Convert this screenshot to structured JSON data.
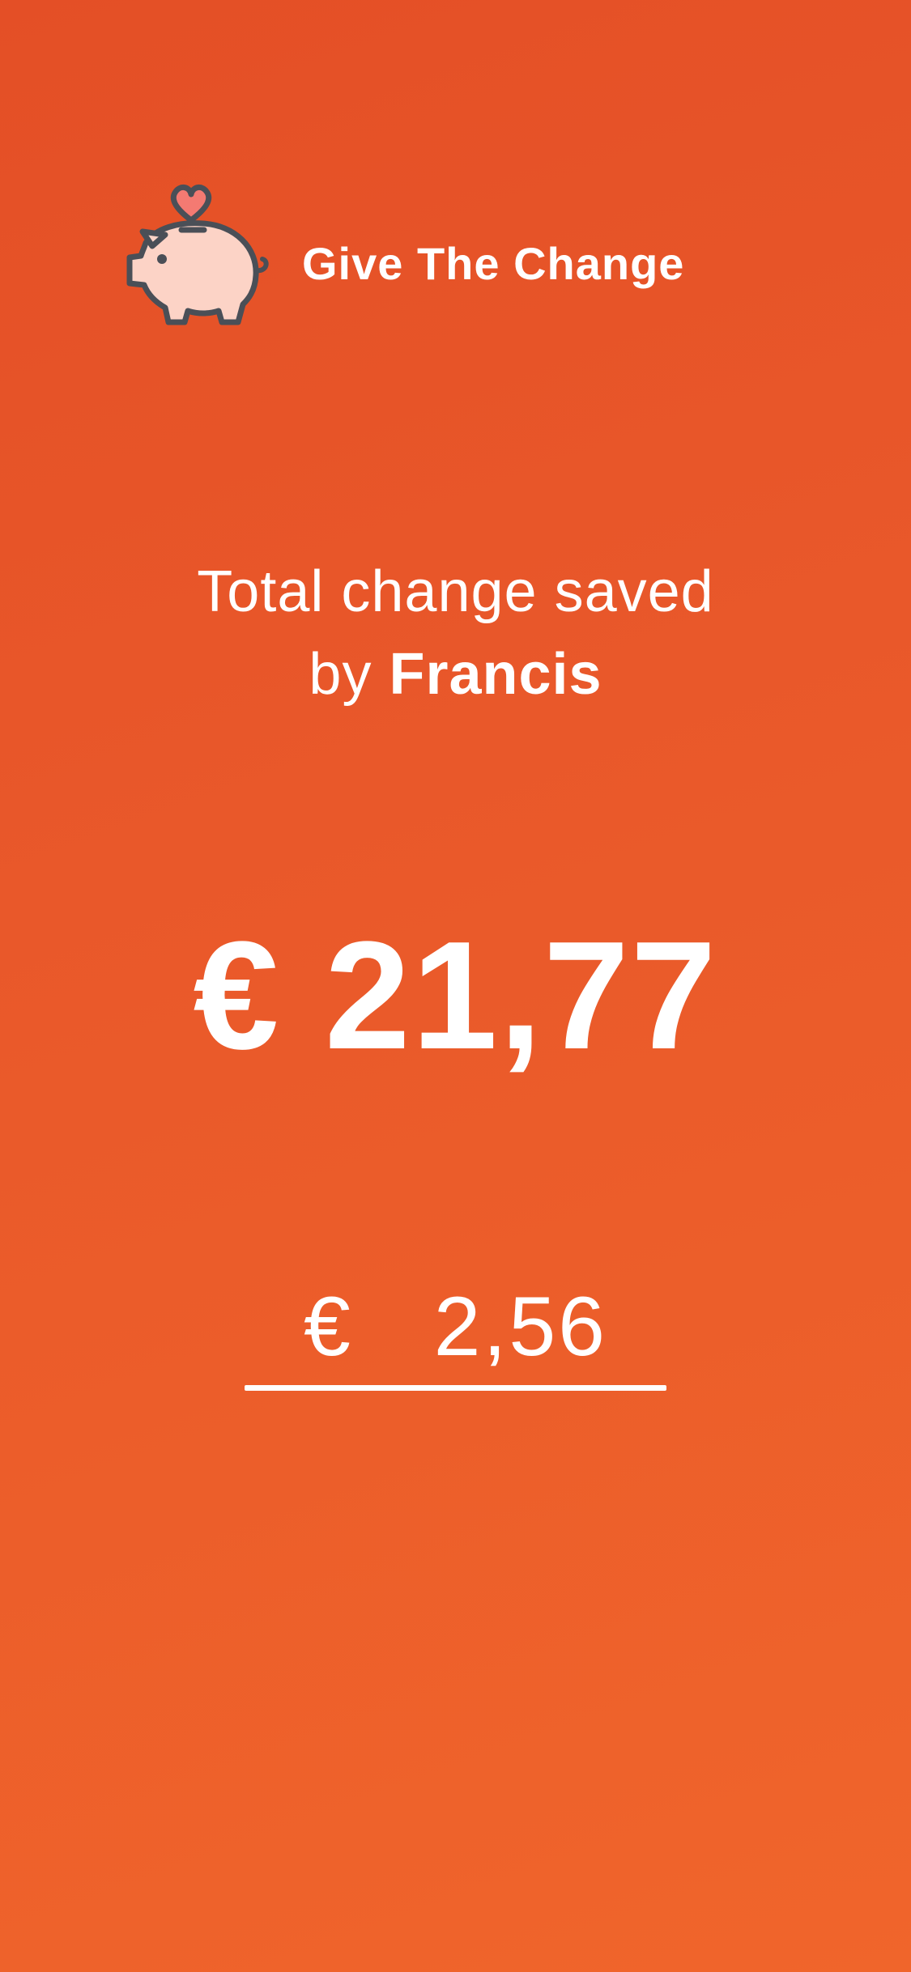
{
  "app": {
    "title": "Give The Change",
    "logo_icon": "piggy-bank-heart-icon"
  },
  "savings": {
    "subtitle_line1": "Total change saved",
    "subtitle_prefix": "by",
    "user_name": "Francis",
    "total_amount": "€ 21,77"
  },
  "change_input": {
    "value": "€  2,56"
  },
  "colors": {
    "background_top": "#e44f26",
    "background_bottom": "#f0652b",
    "text": "#ffffff",
    "logo_fill": "#fcd3c6",
    "logo_outline": "#4a4f57",
    "heart": "#f47a72"
  }
}
